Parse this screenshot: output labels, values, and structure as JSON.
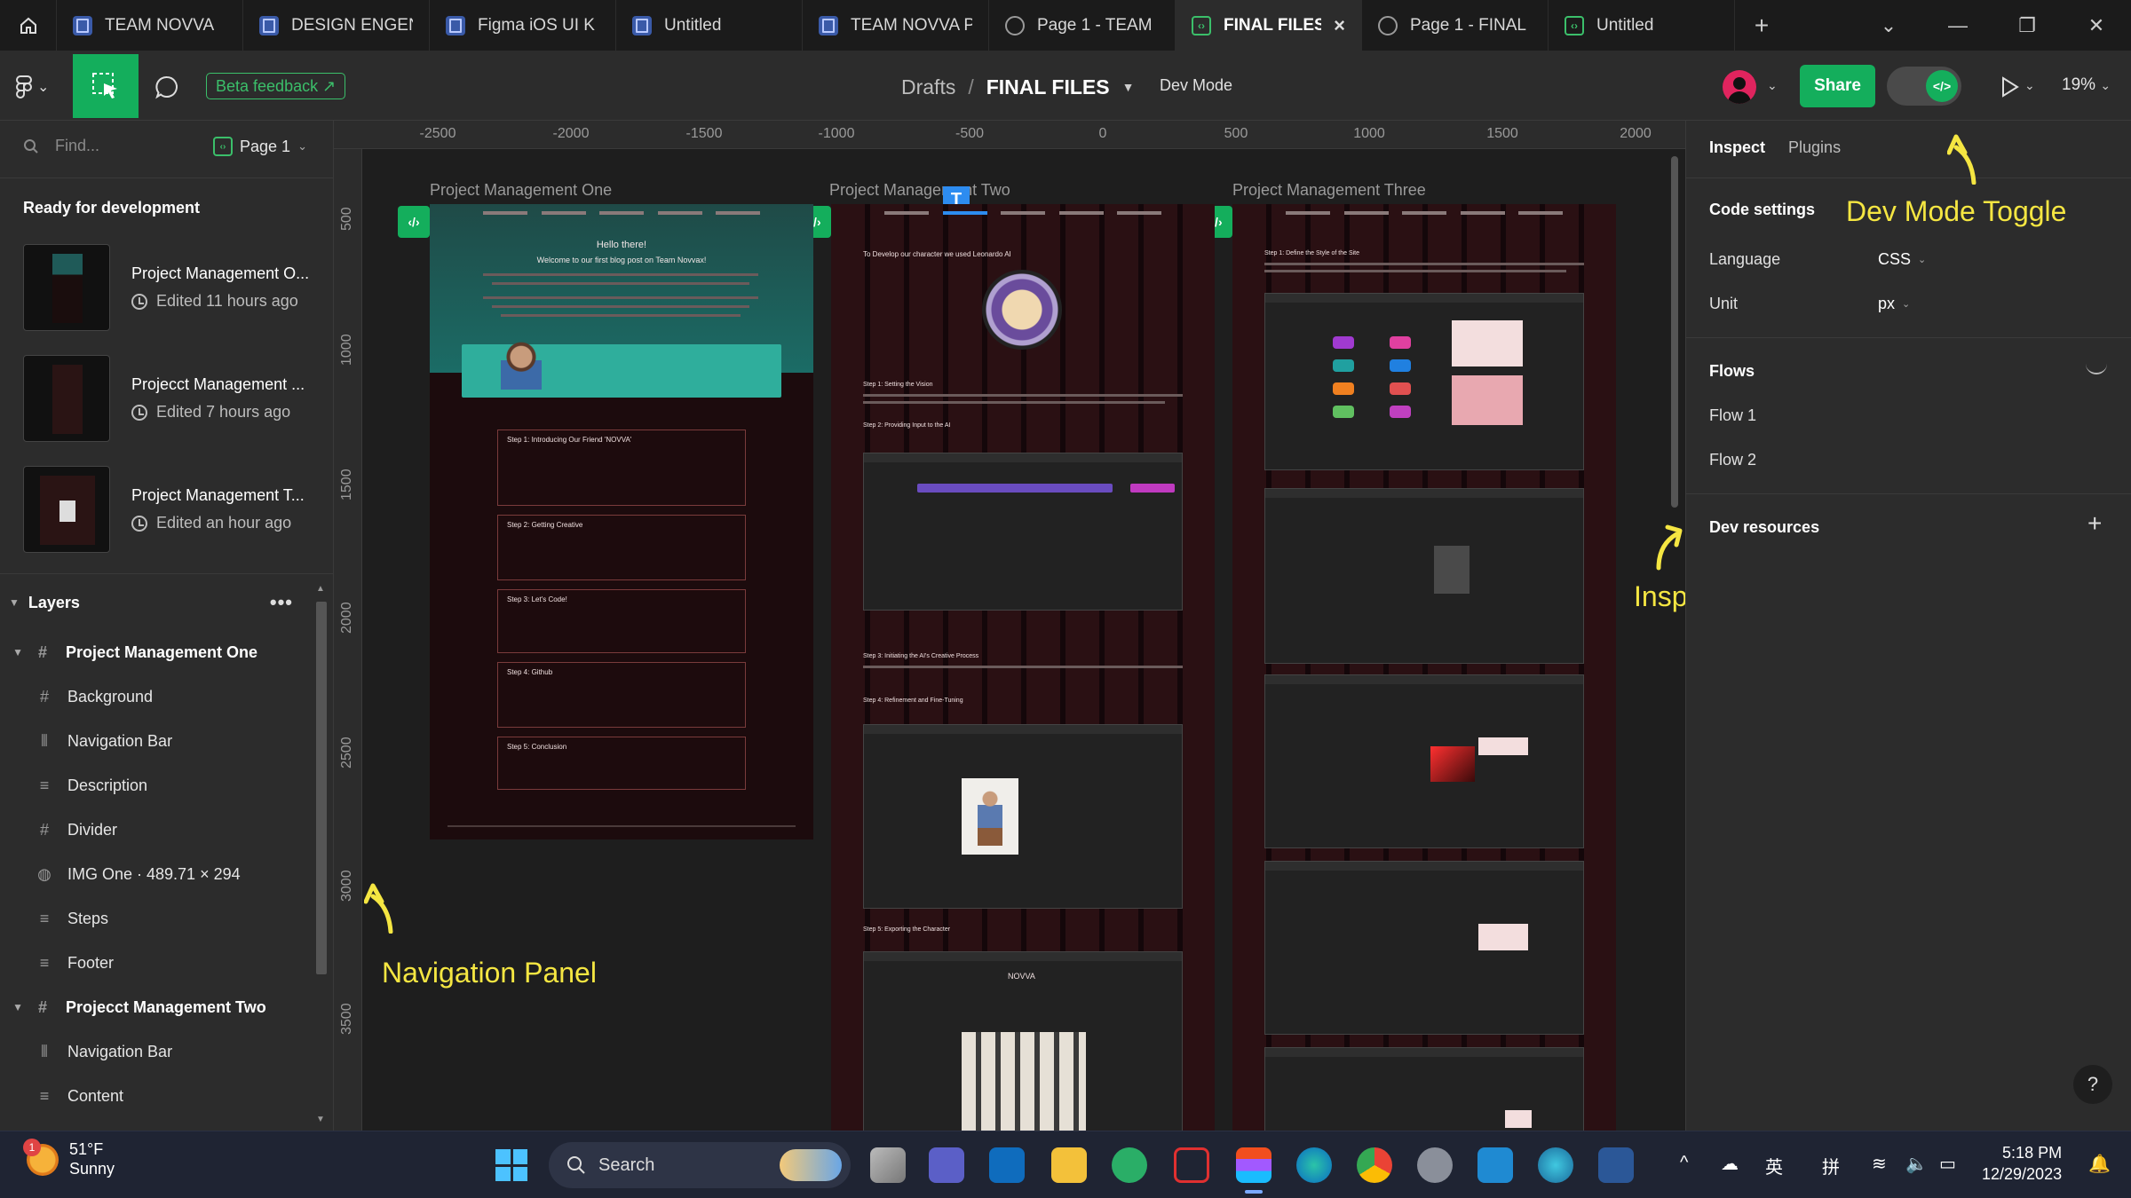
{
  "tabs": [
    {
      "label": "TEAM NOVVA",
      "icon": "file-icon",
      "active": false
    },
    {
      "label": "DESIGN ENGEN",
      "icon": "file-icon",
      "active": false
    },
    {
      "label": "Figma iOS UI K",
      "icon": "file-icon",
      "active": false
    },
    {
      "label": "Untitled",
      "icon": "file-icon",
      "active": false
    },
    {
      "label": "TEAM NOVVA P",
      "icon": "file-icon",
      "active": false
    },
    {
      "label": "Page 1 - TEAM",
      "icon": "play-icon",
      "active": false
    },
    {
      "label": "FINAL FILES",
      "icon": "dev-icon",
      "active": true
    },
    {
      "label": "Page 1 - FINAL",
      "icon": "play-icon",
      "active": false
    },
    {
      "label": "Untitled",
      "icon": "dev-icon",
      "active": false
    }
  ],
  "tab_add": "+",
  "window_controls": {
    "minimize": "—",
    "restore": "❐",
    "close": "✕",
    "dropdown": "⌄"
  },
  "toolbar": {
    "beta_feedback": "Beta feedback ↗",
    "breadcrumb_drafts": "Drafts",
    "breadcrumb_sep": "/",
    "file_name": "FINAL FILES",
    "dev_mode": "Dev Mode",
    "share": "Share",
    "zoom": "19%",
    "dev_toggle_symbol": "</>"
  },
  "left_panel": {
    "search_placeholder": "Find...",
    "page": "Page 1",
    "ready_title": "Ready for development",
    "frames": [
      {
        "name": "Project Management O...",
        "edited": "Edited 11 hours ago"
      },
      {
        "name": "Projecct Management ...",
        "edited": "Edited 7 hours ago"
      },
      {
        "name": "Project Management T...",
        "edited": "Edited an hour ago"
      }
    ],
    "layers_title": "Layers",
    "layers": [
      {
        "name": "Project Management One",
        "icon": "#",
        "level": 0
      },
      {
        "name": "Background",
        "icon": "#",
        "level": 1
      },
      {
        "name": "Navigation Bar",
        "icon": "⦀",
        "level": 1
      },
      {
        "name": "Description",
        "icon": "≡",
        "level": 1
      },
      {
        "name": "Divider",
        "icon": "#",
        "level": 1
      },
      {
        "name": "IMG One · 489.71 × 294",
        "icon": "◍",
        "level": 1
      },
      {
        "name": "Steps",
        "icon": "≡",
        "level": 1
      },
      {
        "name": "Footer",
        "icon": "≡",
        "level": 1
      },
      {
        "name": "Projecct Management Two",
        "icon": "#",
        "level": 0
      },
      {
        "name": "Navigation Bar",
        "icon": "⦀",
        "level": 1
      },
      {
        "name": "Content",
        "icon": "≡",
        "level": 1
      }
    ]
  },
  "ruler": {
    "top_ticks": [
      "-2500",
      "-2000",
      "-1500",
      "-1000",
      "-500",
      "0",
      "500",
      "1000",
      "1500",
      "2000"
    ],
    "left_ticks": [
      "500",
      "1000",
      "1500",
      "2000",
      "2500",
      "3000",
      "3500"
    ]
  },
  "canvas": {
    "frame_labels": [
      "Project Management One",
      "Project Management Two",
      "Project Management Three"
    ],
    "hero_title": "Hello there!",
    "hero_subtitle": "Welcome to our first blog post on Team Novvax!",
    "step_titles": [
      "Step 1: Introducing Our Friend 'NOVVA'",
      "Step 2: Getting Creative",
      "Step 3: Let's Code!",
      "Step 4: Github",
      "Step 5: Conclusion"
    ],
    "frame2_intro": "To Develop our character we used Leonardo AI",
    "frame2_sections": [
      "Step 1: Setting the Vision",
      "Step 2: Providing Input to the AI",
      "Step 3: Initiating the AI's Creative Process",
      "Step 4: Refinement and Fine-Tuning",
      "Step 5: Exporting the Character"
    ],
    "frame3_section": "Step 1: Define the Style of the Site",
    "novva_label": "NOVVA",
    "annotations": {
      "navigation": "Navigation Panel",
      "dev_mode_toggle": "Dev Mode Toggle",
      "inspect": "Inspect Panel"
    },
    "annotation_color": "#f5e642"
  },
  "right_panel": {
    "tabs": [
      "Inspect",
      "Plugins"
    ],
    "code_settings": "Code settings",
    "language_label": "Language",
    "language_value": "CSS",
    "unit_label": "Unit",
    "unit_value": "px",
    "flows_title": "Flows",
    "flows": [
      "Flow 1",
      "Flow 2"
    ],
    "dev_resources": "Dev resources",
    "help": "?"
  },
  "taskbar": {
    "weather_temp": "51°F",
    "weather_desc": "Sunny",
    "weather_badge": "1",
    "search_label": "Search",
    "tray_lang1": "英",
    "tray_lang2": "拼",
    "time": "5:18 PM",
    "date": "12/29/2023"
  },
  "colors": {
    "accent_green": "#14ae5c",
    "annotation_yellow": "#f5e642",
    "panel_bg": "#2c2c2c",
    "canvas_bg": "#1e1e1e"
  }
}
